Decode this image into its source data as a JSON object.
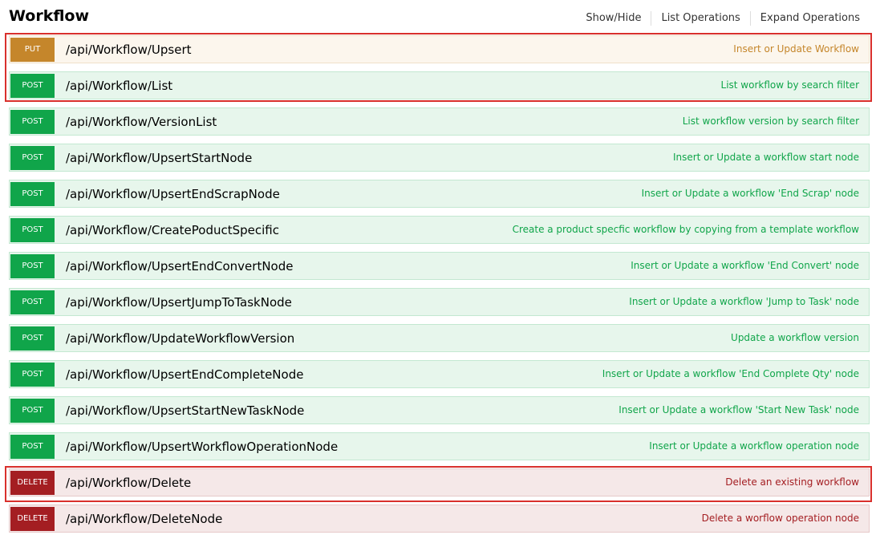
{
  "section": {
    "title": "Workflow",
    "links": {
      "show_hide": "Show/Hide",
      "list_operations": "List Operations",
      "expand_operations": "Expand Operations"
    }
  },
  "colors": {
    "post": "#10a54a",
    "put": "#c5862b",
    "delete": "#a41e22",
    "highlight": "#d9302c"
  },
  "operations": [
    {
      "method": "PUT",
      "path": "/api/Workflow/Upsert",
      "description": "Insert or Update Workflow"
    },
    {
      "method": "POST",
      "path": "/api/Workflow/List",
      "description": "List workflow by search filter"
    },
    {
      "method": "POST",
      "path": "/api/Workflow/VersionList",
      "description": "List workflow version by search filter"
    },
    {
      "method": "POST",
      "path": "/api/Workflow/UpsertStartNode",
      "description": "Insert or Update a workflow start node"
    },
    {
      "method": "POST",
      "path": "/api/Workflow/UpsertEndScrapNode",
      "description": "Insert or Update a workflow 'End Scrap' node"
    },
    {
      "method": "POST",
      "path": "/api/Workflow/CreatePoductSpecific",
      "description": "Create a product specfic workflow by copying from a template workflow"
    },
    {
      "method": "POST",
      "path": "/api/Workflow/UpsertEndConvertNode",
      "description": "Insert or Update a workflow 'End Convert' node"
    },
    {
      "method": "POST",
      "path": "/api/Workflow/UpsertJumpToTaskNode",
      "description": "Insert or Update a workflow 'Jump to Task' node"
    },
    {
      "method": "POST",
      "path": "/api/Workflow/UpdateWorkflowVersion",
      "description": "Update a workflow version"
    },
    {
      "method": "POST",
      "path": "/api/Workflow/UpsertEndCompleteNode",
      "description": "Insert or Update a workflow 'End Complete Qty' node"
    },
    {
      "method": "POST",
      "path": "/api/Workflow/UpsertStartNewTaskNode",
      "description": "Insert or Update a workflow 'Start New Task' node"
    },
    {
      "method": "POST",
      "path": "/api/Workflow/UpsertWorkflowOperationNode",
      "description": "Insert or Update a workflow operation node"
    },
    {
      "method": "DELETE",
      "path": "/api/Workflow/Delete",
      "description": "Delete an existing workflow"
    },
    {
      "method": "DELETE",
      "path": "/api/Workflow/DeleteNode",
      "description": "Delete a worflow operation node"
    }
  ]
}
